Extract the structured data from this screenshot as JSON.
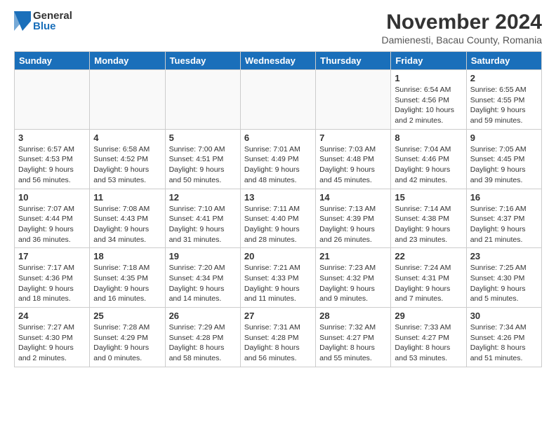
{
  "logo": {
    "general": "General",
    "blue": "Blue"
  },
  "title": "November 2024",
  "subtitle": "Damienesti, Bacau County, Romania",
  "headers": [
    "Sunday",
    "Monday",
    "Tuesday",
    "Wednesday",
    "Thursday",
    "Friday",
    "Saturday"
  ],
  "weeks": [
    [
      {
        "num": "",
        "info": ""
      },
      {
        "num": "",
        "info": ""
      },
      {
        "num": "",
        "info": ""
      },
      {
        "num": "",
        "info": ""
      },
      {
        "num": "",
        "info": ""
      },
      {
        "num": "1",
        "info": "Sunrise: 6:54 AM\nSunset: 4:56 PM\nDaylight: 10 hours\nand 2 minutes."
      },
      {
        "num": "2",
        "info": "Sunrise: 6:55 AM\nSunset: 4:55 PM\nDaylight: 9 hours\nand 59 minutes."
      }
    ],
    [
      {
        "num": "3",
        "info": "Sunrise: 6:57 AM\nSunset: 4:53 PM\nDaylight: 9 hours\nand 56 minutes."
      },
      {
        "num": "4",
        "info": "Sunrise: 6:58 AM\nSunset: 4:52 PM\nDaylight: 9 hours\nand 53 minutes."
      },
      {
        "num": "5",
        "info": "Sunrise: 7:00 AM\nSunset: 4:51 PM\nDaylight: 9 hours\nand 50 minutes."
      },
      {
        "num": "6",
        "info": "Sunrise: 7:01 AM\nSunset: 4:49 PM\nDaylight: 9 hours\nand 48 minutes."
      },
      {
        "num": "7",
        "info": "Sunrise: 7:03 AM\nSunset: 4:48 PM\nDaylight: 9 hours\nand 45 minutes."
      },
      {
        "num": "8",
        "info": "Sunrise: 7:04 AM\nSunset: 4:46 PM\nDaylight: 9 hours\nand 42 minutes."
      },
      {
        "num": "9",
        "info": "Sunrise: 7:05 AM\nSunset: 4:45 PM\nDaylight: 9 hours\nand 39 minutes."
      }
    ],
    [
      {
        "num": "10",
        "info": "Sunrise: 7:07 AM\nSunset: 4:44 PM\nDaylight: 9 hours\nand 36 minutes."
      },
      {
        "num": "11",
        "info": "Sunrise: 7:08 AM\nSunset: 4:43 PM\nDaylight: 9 hours\nand 34 minutes."
      },
      {
        "num": "12",
        "info": "Sunrise: 7:10 AM\nSunset: 4:41 PM\nDaylight: 9 hours\nand 31 minutes."
      },
      {
        "num": "13",
        "info": "Sunrise: 7:11 AM\nSunset: 4:40 PM\nDaylight: 9 hours\nand 28 minutes."
      },
      {
        "num": "14",
        "info": "Sunrise: 7:13 AM\nSunset: 4:39 PM\nDaylight: 9 hours\nand 26 minutes."
      },
      {
        "num": "15",
        "info": "Sunrise: 7:14 AM\nSunset: 4:38 PM\nDaylight: 9 hours\nand 23 minutes."
      },
      {
        "num": "16",
        "info": "Sunrise: 7:16 AM\nSunset: 4:37 PM\nDaylight: 9 hours\nand 21 minutes."
      }
    ],
    [
      {
        "num": "17",
        "info": "Sunrise: 7:17 AM\nSunset: 4:36 PM\nDaylight: 9 hours\nand 18 minutes."
      },
      {
        "num": "18",
        "info": "Sunrise: 7:18 AM\nSunset: 4:35 PM\nDaylight: 9 hours\nand 16 minutes."
      },
      {
        "num": "19",
        "info": "Sunrise: 7:20 AM\nSunset: 4:34 PM\nDaylight: 9 hours\nand 14 minutes."
      },
      {
        "num": "20",
        "info": "Sunrise: 7:21 AM\nSunset: 4:33 PM\nDaylight: 9 hours\nand 11 minutes."
      },
      {
        "num": "21",
        "info": "Sunrise: 7:23 AM\nSunset: 4:32 PM\nDaylight: 9 hours\nand 9 minutes."
      },
      {
        "num": "22",
        "info": "Sunrise: 7:24 AM\nSunset: 4:31 PM\nDaylight: 9 hours\nand 7 minutes."
      },
      {
        "num": "23",
        "info": "Sunrise: 7:25 AM\nSunset: 4:30 PM\nDaylight: 9 hours\nand 5 minutes."
      }
    ],
    [
      {
        "num": "24",
        "info": "Sunrise: 7:27 AM\nSunset: 4:30 PM\nDaylight: 9 hours\nand 2 minutes."
      },
      {
        "num": "25",
        "info": "Sunrise: 7:28 AM\nSunset: 4:29 PM\nDaylight: 9 hours\nand 0 minutes."
      },
      {
        "num": "26",
        "info": "Sunrise: 7:29 AM\nSunset: 4:28 PM\nDaylight: 8 hours\nand 58 minutes."
      },
      {
        "num": "27",
        "info": "Sunrise: 7:31 AM\nSunset: 4:28 PM\nDaylight: 8 hours\nand 56 minutes."
      },
      {
        "num": "28",
        "info": "Sunrise: 7:32 AM\nSunset: 4:27 PM\nDaylight: 8 hours\nand 55 minutes."
      },
      {
        "num": "29",
        "info": "Sunrise: 7:33 AM\nSunset: 4:27 PM\nDaylight: 8 hours\nand 53 minutes."
      },
      {
        "num": "30",
        "info": "Sunrise: 7:34 AM\nSunset: 4:26 PM\nDaylight: 8 hours\nand 51 minutes."
      }
    ]
  ]
}
